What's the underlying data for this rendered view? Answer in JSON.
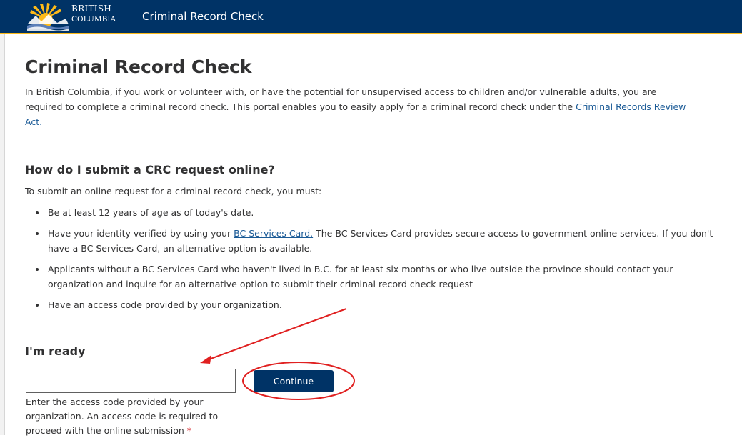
{
  "header": {
    "logo_line1": "BRITISH",
    "logo_line2": "COLUMBIA",
    "app_title": "Criminal Record Check",
    "colors": {
      "bar": "#003366",
      "accent": "#fcba19"
    }
  },
  "main": {
    "title": "Criminal Record Check",
    "intro_before_link": "In British Columbia, if you work or volunteer with, or have the potential for unsupervised access to children and/or vulnerable adults, you are required to complete a criminal record check. This portal enables you to easily apply for a criminal record check under the ",
    "intro_link": "Criminal Records Review Act.",
    "submit_heading": "How do I submit a CRC request online?",
    "submit_lead": "To submit an online request for a criminal record check, you must:",
    "requirements": {
      "age": "Be at least 12 years of age as of today's date.",
      "identity_before_link": "Have your identity verified by using your ",
      "identity_link": "BC Services Card.",
      "identity_after_link": " The BC Services Card provides secure access to government online services. If you don't have a BC Services Card, an alternative option is available.",
      "applicants": "Applicants without a BC Services Card who haven't lived in B.C. for at least six months or who live outside the province should contact your organization and inquire for an alternative option to submit their criminal record check request",
      "access_code": "Have an access code provided by your organization."
    },
    "ready_heading": "I'm ready",
    "access_code_input": {
      "value": "",
      "placeholder": ""
    },
    "continue_label": "Continue",
    "helper_text": "Enter the access code provided by your organization. An access code is required to proceed with the online submission",
    "required_marker": "*"
  },
  "annotations": {
    "color": "#e02020",
    "arrow": "arrow pointing to access code field",
    "circle": "circle around Continue button"
  }
}
